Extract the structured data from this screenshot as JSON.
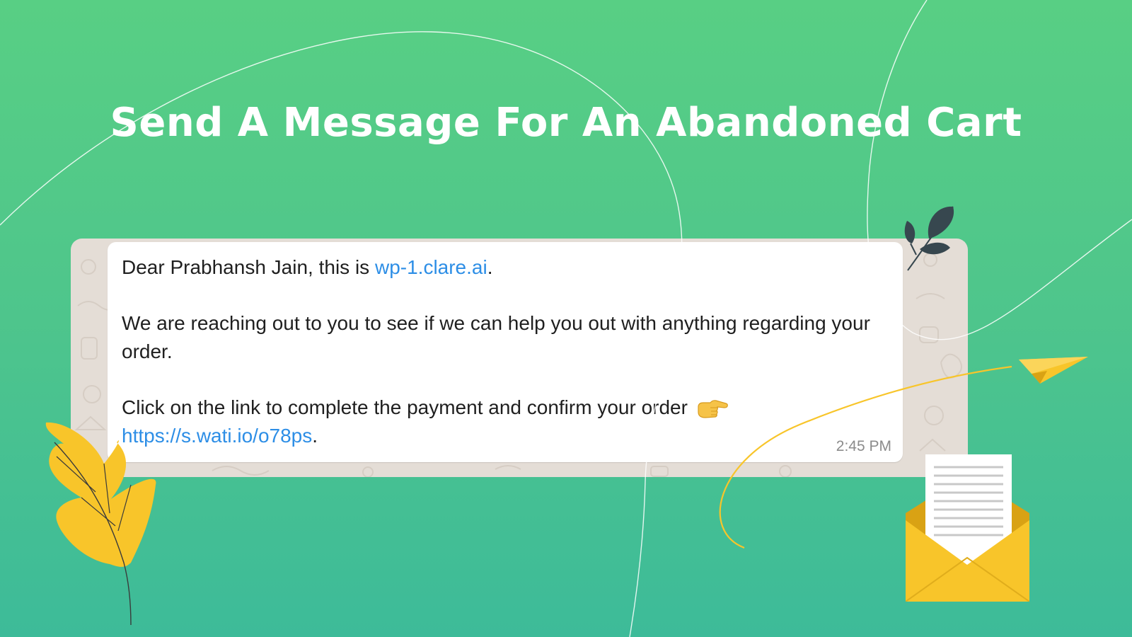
{
  "page": {
    "headline": "Send A Message For An Abandoned Cart"
  },
  "message": {
    "greeting_prefix": "Dear Prabhansh Jain, this is ",
    "greeting_link": "wp-1.clare.ai",
    "greeting_suffix": ".",
    "body": "We are reaching out to you to see if we can help you out with anything regarding your order.",
    "cta_text": "Click on the link to complete the payment and confirm your order",
    "cta_emoji": "pointing-right-hand-emoji",
    "cta_link": "https://s.wati.io/o78ps",
    "cta_suffix": ".",
    "timestamp": "2:45 PM"
  },
  "colors": {
    "background_top": "#58cf84",
    "background_bottom": "#3dbb99",
    "chat_wallpaper": "#e4ddd6",
    "bubble": "#ffffff",
    "link": "#2d8ee6",
    "accent_yellow": "#f8c52a",
    "dark_leaf": "#37474f"
  },
  "decorations": {
    "icons": [
      "yellow-leaf-icon",
      "dark-leaf-sprig-icon",
      "paper-plane-icon",
      "envelope-letter-icon"
    ]
  }
}
